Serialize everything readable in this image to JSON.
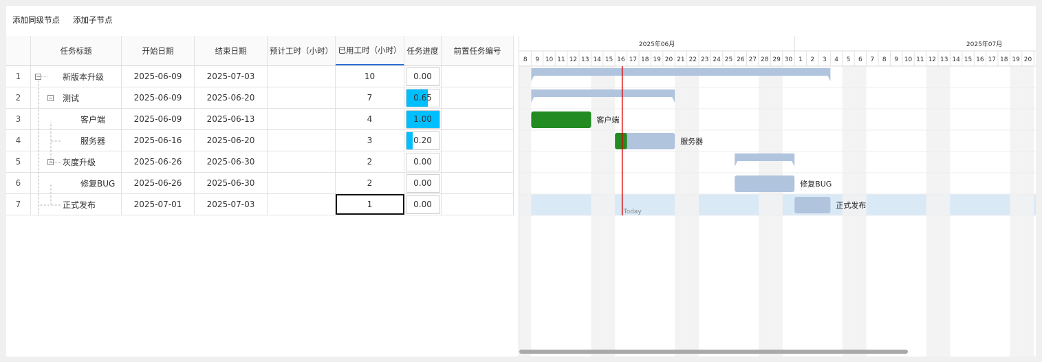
{
  "toolbar": {
    "add_sibling": "添加同级节点",
    "add_child": "添加子节点"
  },
  "grid": {
    "headers": {
      "title": "任务标题",
      "start": "开始日期",
      "end": "结束日期",
      "estimated": "预计工时（小时）",
      "used": "已用工时（小时）",
      "progress": "任务进度",
      "predecessor": "前置任务编号"
    },
    "rows": [
      {
        "index": "1",
        "title": "新版本升级",
        "start": "2025-06-09",
        "end": "2025-07-03",
        "estimated": "",
        "used": "10",
        "progress": "0.00",
        "progress_value": 0,
        "predecessor": "",
        "level": 0
      },
      {
        "index": "2",
        "title": "测试",
        "start": "2025-06-09",
        "end": "2025-06-20",
        "estimated": "",
        "used": "7",
        "progress": "0.65",
        "progress_value": 0.65,
        "predecessor": "",
        "level": 1
      },
      {
        "index": "3",
        "title": "客户端",
        "start": "2025-06-09",
        "end": "2025-06-13",
        "estimated": "",
        "used": "4",
        "progress": "1.00",
        "progress_value": 1,
        "predecessor": "",
        "level": 2
      },
      {
        "index": "4",
        "title": "服务器",
        "start": "2025-06-16",
        "end": "2025-06-20",
        "estimated": "",
        "used": "3",
        "progress": "0.20",
        "progress_value": 0.2,
        "predecessor": "",
        "level": 2
      },
      {
        "index": "5",
        "title": "灰度升级",
        "start": "2025-06-26",
        "end": "2025-06-30",
        "estimated": "",
        "used": "2",
        "progress": "0.00",
        "progress_value": 0,
        "predecessor": "",
        "level": 1
      },
      {
        "index": "6",
        "title": "修复BUG",
        "start": "2025-06-26",
        "end": "2025-06-30",
        "estimated": "",
        "used": "2",
        "progress": "0.00",
        "progress_value": 0,
        "predecessor": "",
        "level": 2
      },
      {
        "index": "7",
        "title": "正式发布",
        "start": "2025-07-01",
        "end": "2025-07-03",
        "estimated": "",
        "used": "1",
        "progress": "0.00",
        "progress_value": 0,
        "predecessor": "",
        "level": 1
      }
    ]
  },
  "gantt": {
    "months": [
      "2025年06月",
      "2025年07月"
    ],
    "days": [
      "8",
      "9",
      "10",
      "11",
      "12",
      "13",
      "14",
      "15",
      "16",
      "17",
      "18",
      "19",
      "20",
      "21",
      "22",
      "23",
      "24",
      "25",
      "26",
      "27",
      "28",
      "29",
      "30",
      "1",
      "2",
      "3",
      "4",
      "5",
      "6",
      "7",
      "8",
      "9",
      "10",
      "11",
      "12",
      "13",
      "14",
      "15",
      "16",
      "17",
      "18",
      "19",
      "20"
    ],
    "today_label": "Today",
    "bars": [
      {
        "row": 0,
        "kind": "summary",
        "start": "2025-06-09",
        "end": "2025-07-03",
        "label": ""
      },
      {
        "row": 1,
        "kind": "summary",
        "start": "2025-06-09",
        "end": "2025-06-20",
        "label": ""
      },
      {
        "row": 2,
        "kind": "task",
        "start": "2025-06-09",
        "end": "2025-06-13",
        "progress": 1,
        "label": "客户端"
      },
      {
        "row": 3,
        "kind": "task",
        "start": "2025-06-16",
        "end": "2025-06-20",
        "progress": 0.2,
        "label": "服务器"
      },
      {
        "row": 4,
        "kind": "summary",
        "start": "2025-06-26",
        "end": "2025-06-30",
        "label": ""
      },
      {
        "row": 5,
        "kind": "task",
        "start": "2025-06-26",
        "end": "2025-06-30",
        "progress": 0,
        "label": "修复BUG"
      },
      {
        "row": 6,
        "kind": "task",
        "start": "2025-07-01",
        "end": "2025-07-03",
        "progress": 0,
        "label": "正式发布"
      }
    ],
    "colors": {
      "bar": "#b0c4de",
      "progress": "#228b22",
      "today": "#e00000",
      "weekend": "#f2f2f2",
      "selected_row": "#d9e9f5"
    }
  }
}
